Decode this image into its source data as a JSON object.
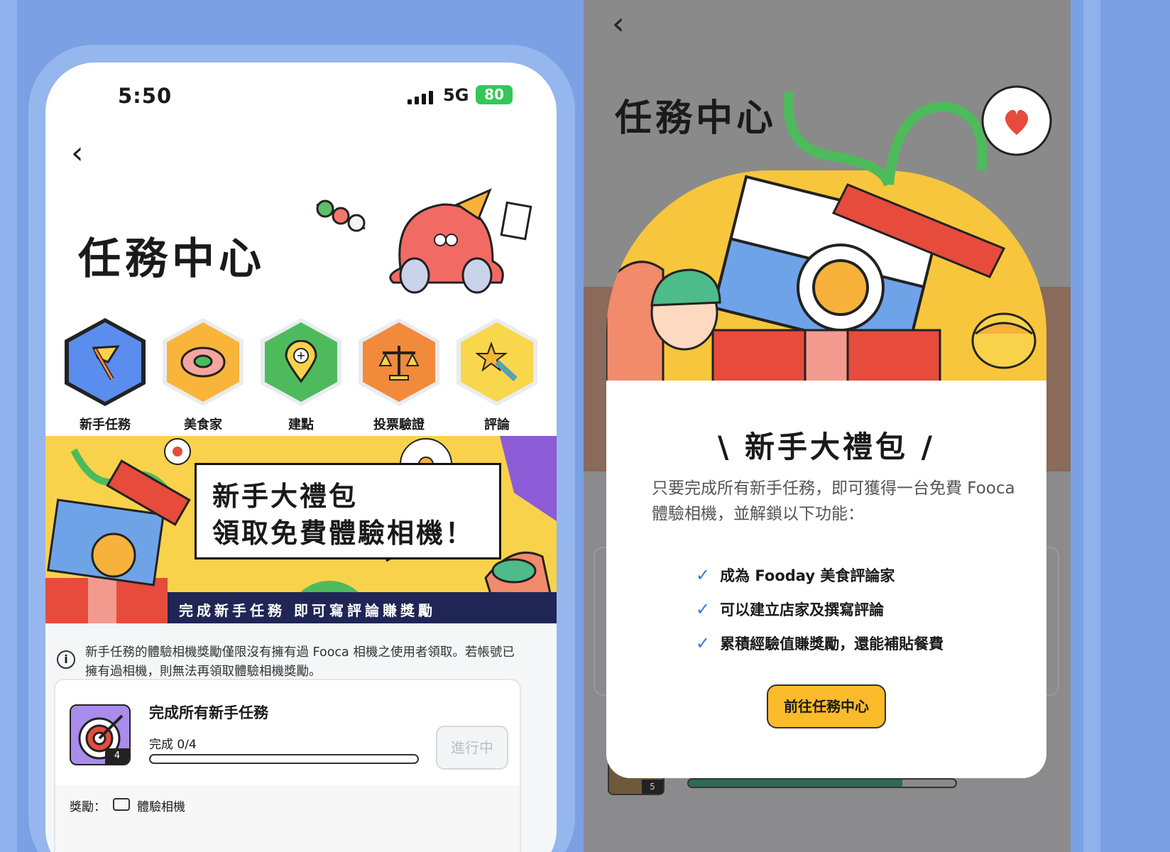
{
  "left": {
    "status_bar": {
      "time": "5:50",
      "network": "5G",
      "battery": "80"
    },
    "page_title": "任務中心",
    "badges": [
      {
        "label": "新手任務",
        "icon": "flag-pen-icon",
        "color": "#5B8DEF"
      },
      {
        "label": "美食家",
        "icon": "donut-icon",
        "color": "#F8B53A"
      },
      {
        "label": "建點",
        "icon": "map-pin-add-icon",
        "color": "#4DBB5B"
      },
      {
        "label": "投票驗證",
        "icon": "scales-icon",
        "color": "#F28A3C"
      },
      {
        "label": "評論",
        "icon": "star-comet-icon",
        "color": "#F9D74C"
      }
    ],
    "banner": {
      "line1": "新手大禮包",
      "line2": "領取免費體驗相機！",
      "strip": "完成新手任務 即可寫評論賺獎勵"
    },
    "notice": "新手任務的體驗相機獎勵僅限沒有擁有過 Fooca 相機之使用者領取。若帳號已擁有過相機，則無法再領取體驗相機獎勵。",
    "task": {
      "title": "完成所有新手任務",
      "progress_text": "完成 0/4",
      "progress": 0,
      "count": "4",
      "status": "進行中",
      "reward_label": "獎勵：",
      "reward_item": "體驗相機"
    }
  },
  "right": {
    "page_title": "任務中心",
    "modal": {
      "title": "\\ 新手大禮包 /",
      "description": "只要完成所有新手任務，即可獲得一台免費 Fooca 體驗相機，並解鎖以下功能：",
      "features": [
        "成為 Fooday 美食評論家",
        "可以建立店家及撰寫評論",
        "累積經驗值賺獎勵，還能補貼餐費"
      ],
      "button": "前往任務中心"
    },
    "background_task": {
      "count": "5",
      "progress": 0.8
    }
  }
}
